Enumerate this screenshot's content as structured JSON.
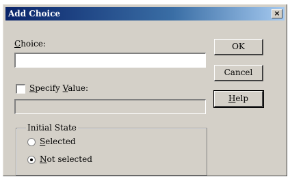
{
  "window": {
    "title": "Add Choice",
    "close_glyph": "×"
  },
  "choice": {
    "label_pre": "",
    "label_key": "C",
    "label_post": "hoice:",
    "value": ""
  },
  "specify_value": {
    "label_pre": "",
    "label_key": "S",
    "label_post": "pecify ",
    "label_key2": "V",
    "label_post2": "alue:",
    "checked": false,
    "value": ""
  },
  "initial_state": {
    "title": "Initial State",
    "selected": {
      "label_key": "S",
      "label_post": "elected",
      "checked": false
    },
    "not_selected": {
      "label_key": "N",
      "label_post": "ot selected",
      "checked": true
    }
  },
  "buttons": {
    "ok": "OK",
    "cancel": "Cancel",
    "help_key": "H",
    "help_post": "elp"
  }
}
